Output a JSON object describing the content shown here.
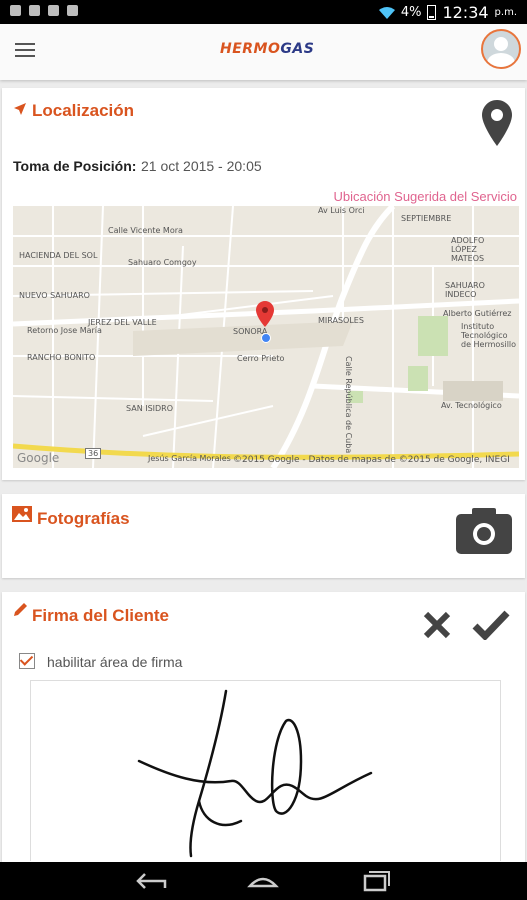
{
  "status_bar": {
    "battery": "4%",
    "time": "12:34",
    "ampm": "p.m."
  },
  "app": {
    "logo_part1": "HERMO",
    "logo_part2": "GAS"
  },
  "location": {
    "title": "Localización",
    "position_label": "Toma de Posición:",
    "position_value": "21 oct 2015 - 20:05",
    "suggested_link": "Ubicación Sugerida del Servicio",
    "map": {
      "labels": [
        "Av Luis Orci",
        "HACIENDA DEL SOL",
        "NUEVO SAHUARO",
        "Calle Vicente Mora",
        "Sahuaro Comgoy",
        "JEREZ DEL VALLE",
        "Retorno Jose María",
        "RANCHO BONITO",
        "SONORA",
        "Cerro Prieto",
        "SAN ISIDRO",
        "MIRASOLES",
        "ADOLFO LÓPEZ MATEOS",
        "SAHUARO INDECO",
        "Alberto Gutiérrez",
        "Instituto Tecnológico de Hermosillo",
        "Av. Tecnológico",
        "Calle República de Cuba",
        "Jesús García Morales",
        "SEPTIEMBRE"
      ],
      "attribution": "©2015 Google - Datos de mapas de ©2015 de Google, INEGI",
      "google": "Google",
      "route": "36"
    },
    "colors": {
      "accent": "#d9541f",
      "pin": "#e53935",
      "dot": "#4285f4"
    }
  },
  "photos": {
    "title": "Fotografías"
  },
  "signature": {
    "title": "Firma del Cliente",
    "checkbox_label": "habilitar área de firma",
    "checkbox_checked": true
  }
}
